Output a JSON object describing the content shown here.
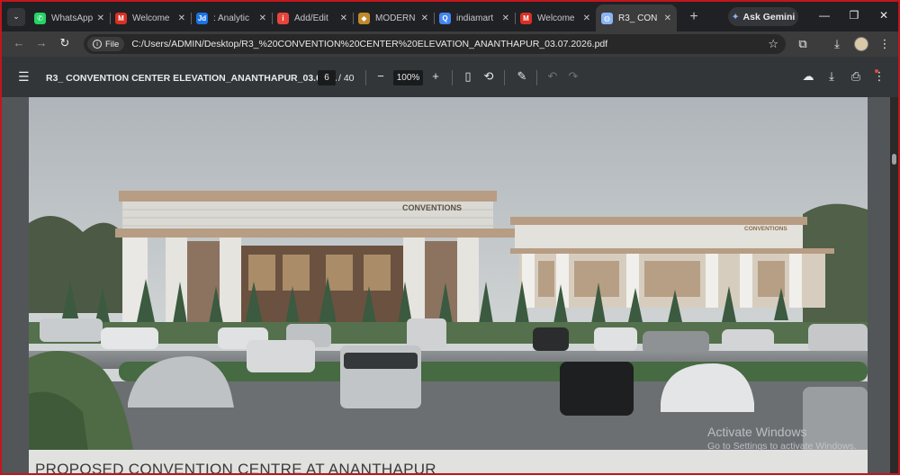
{
  "browser": {
    "tabs": [
      {
        "title": "WhatsApp",
        "favicon": "whatsapp-icon",
        "color": "#25d366",
        "glyph": "✆"
      },
      {
        "title": "Welcome",
        "favicon": "gmail-icon",
        "color": "#d93025",
        "glyph": "M"
      },
      {
        "title": ": Analytic",
        "favicon": "jd-icon",
        "color": "#1a73e8",
        "glyph": "Jd"
      },
      {
        "title": "Add/Edit",
        "favicon": "indiamart-icon",
        "color": "#e8453c",
        "glyph": "i"
      },
      {
        "title": "MODERN",
        "favicon": "modern-icon",
        "color": "#c08a2b",
        "glyph": "◆"
      },
      {
        "title": "indiamart",
        "favicon": "search-icon",
        "color": "#4285f4",
        "glyph": "Q"
      },
      {
        "title": "Welcome",
        "favicon": "gmail-icon",
        "color": "#d93025",
        "glyph": "M"
      },
      {
        "title": "R3_ CON",
        "favicon": "globe-icon",
        "color": "#8ab4f8",
        "glyph": "◍"
      }
    ],
    "gemini_label": "Ask Gemini",
    "file_chip": "File",
    "url": "C:/Users/ADMIN/Desktop/R3_%20CONVENTION%20CENTER%20ELEVATION_ANANTHAPUR_03.07.2026.pdf"
  },
  "pdf": {
    "title": "R3_ CONVENTION CENTER ELEVATION_ANANTHAPUR_03.07....",
    "current_page": "6",
    "total_pages": "/ 40",
    "zoom": "100%"
  },
  "page": {
    "caption": "PROPOSED CONVENTION CENTRE AT ANANTHAPUR",
    "sign_left": "CONVENTIONS",
    "sign_right": "CONVENTIONS"
  },
  "overlay": {
    "activate_title": "Activate Windows",
    "activate_subtitle": "Go to Settings to activate Windows."
  },
  "colors": {
    "frame_border": "#c4151c",
    "tabstrip": "#202124",
    "pdf_toolbar": "#323639",
    "accent_blue": "#8ab4f8"
  }
}
